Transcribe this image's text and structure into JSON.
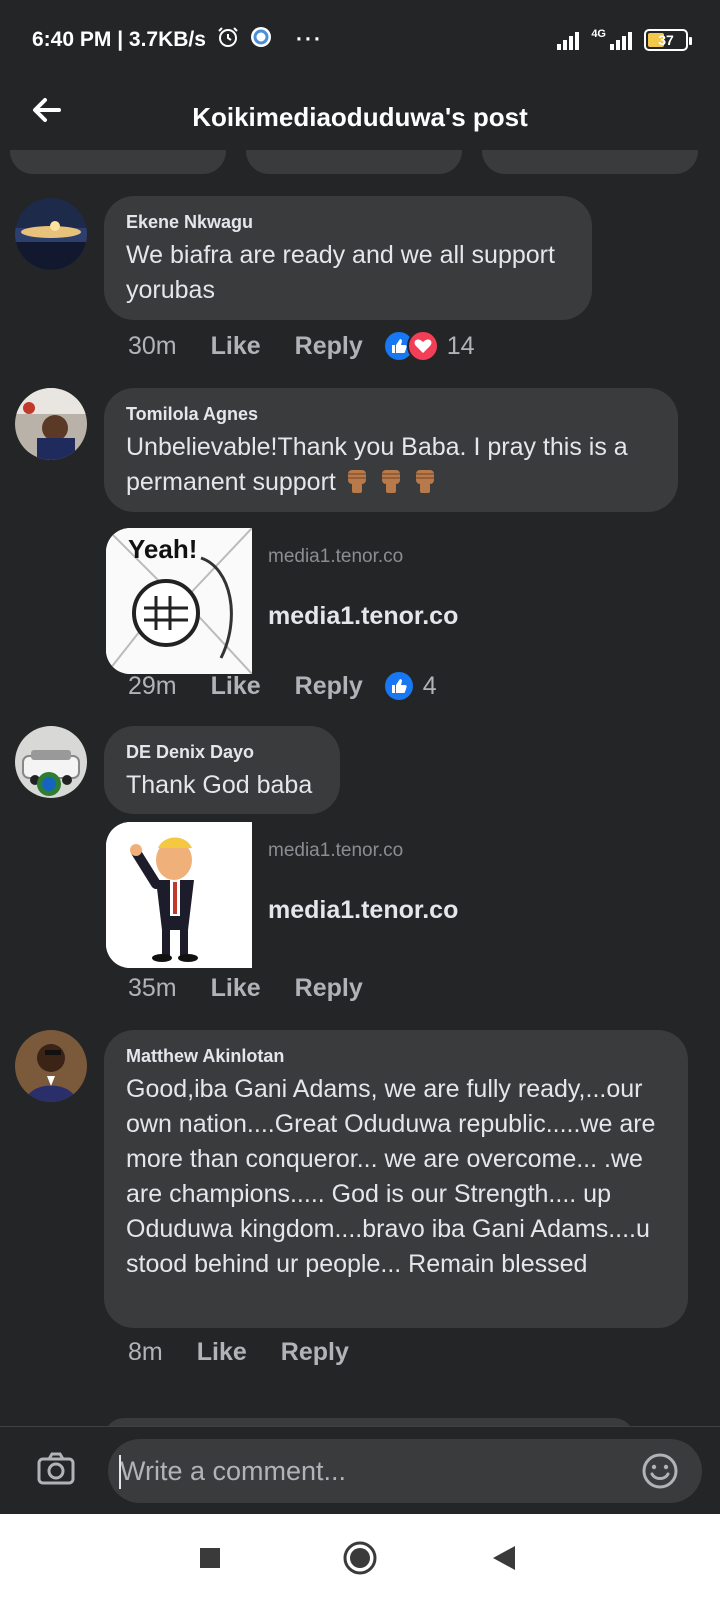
{
  "status_bar": {
    "time_speed": "6:40 PM | 3.7KB/s",
    "more": "···",
    "network": "4G",
    "battery": "37"
  },
  "header": {
    "title": "Koikimediaoduduwa's post"
  },
  "comments": [
    {
      "author": "Ekene Nkwagu",
      "text": "We biafra are ready and we all support yorubas",
      "time": "30m",
      "like": "Like",
      "reply": "Reply",
      "reaction_icons": [
        "like-icon",
        "love-icon"
      ],
      "reaction_count": "14"
    },
    {
      "author": "Tomilola Agnes",
      "text": "Unbelievable!Thank you Baba. I pray this is a permanent support",
      "emojis": [
        "raised-fist-icon",
        "raised-fist-icon",
        "raised-fist-icon"
      ],
      "link": {
        "domain": "media1.tenor.co",
        "title": "media1.tenor.co",
        "thumb_text": "Yeah!"
      },
      "time": "29m",
      "like": "Like",
      "reply": "Reply",
      "reaction_icons": [
        "like-icon"
      ],
      "reaction_count": "4"
    },
    {
      "author": "DE Denix Dayo",
      "text": "Thank God baba",
      "link": {
        "domain": "media1.tenor.co",
        "title": "media1.tenor.co"
      },
      "time": "35m",
      "like": "Like",
      "reply": "Reply"
    },
    {
      "author": "Matthew Akinlotan",
      "text": "Good,iba Gani Adams, we are fully ready,...our own nation....Great Oduduwa republic.....we are more than conqueror... we are overcome... .we are champions..... God is our Strength.... up Oduduwa kingdom....bravo iba Gani Adams....u stood behind ur people... Remain blessed",
      "time": "8m",
      "like": "Like",
      "reply": "Reply"
    }
  ],
  "composer": {
    "placeholder": "Write a comment..."
  },
  "colors": {
    "background": "#242526",
    "bubble": "#3a3b3c",
    "like_blue": "#1877f2",
    "love_red": "#f33e58"
  }
}
